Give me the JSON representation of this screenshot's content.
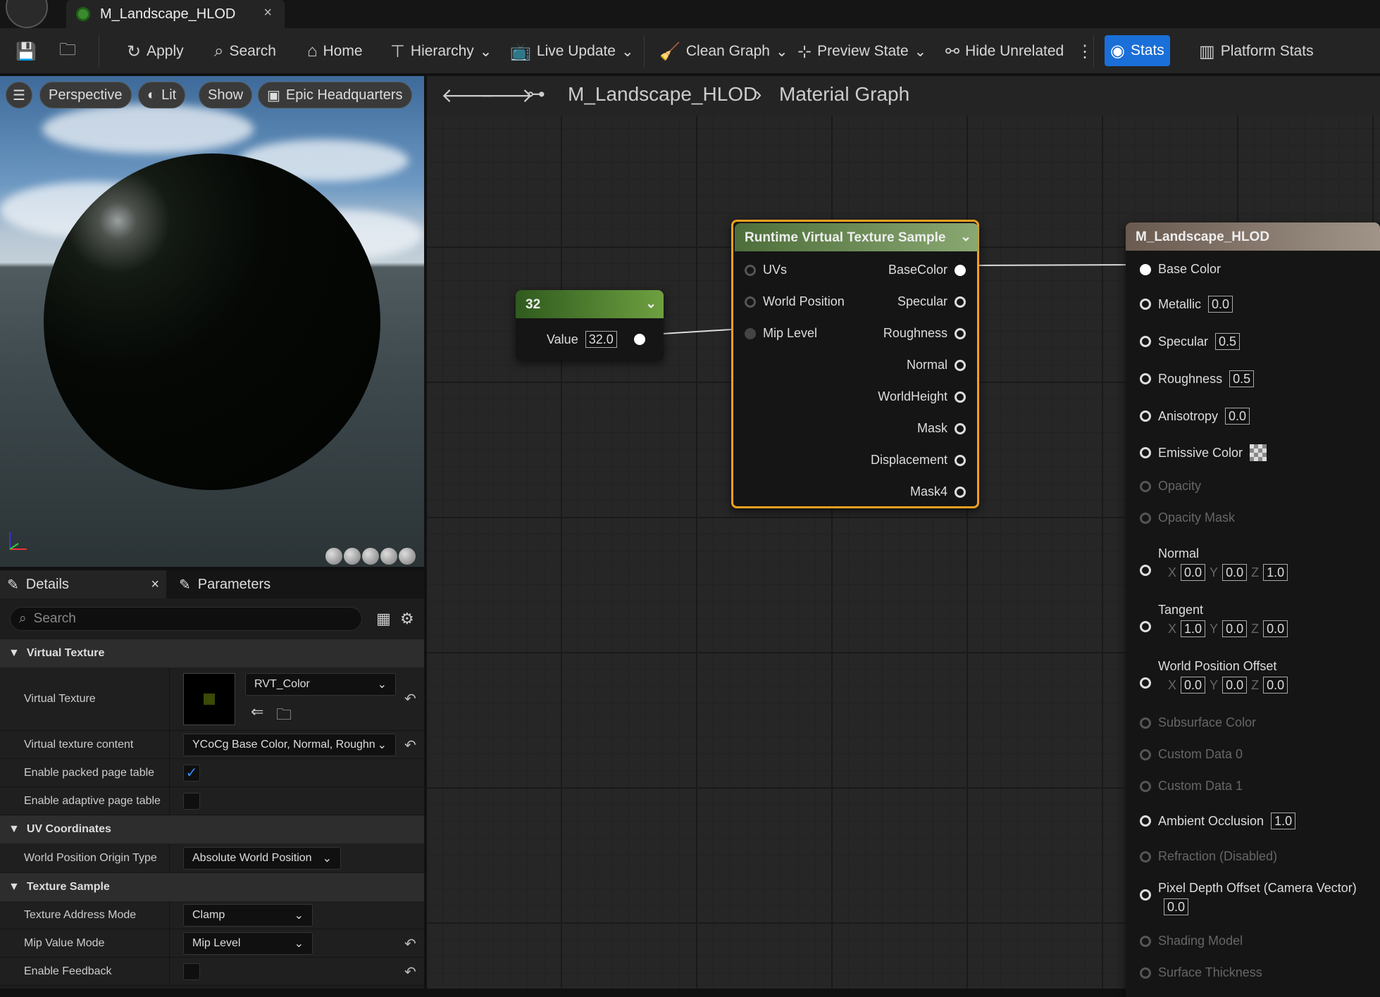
{
  "tab": {
    "title": "M_Landscape_HLOD",
    "close": "×"
  },
  "toolbar": {
    "apply": "Apply",
    "search": "Search",
    "home": "Home",
    "hierarchy": "Hierarchy",
    "live_update": "Live Update",
    "clean_graph": "Clean Graph",
    "preview_state": "Preview State",
    "hide_unrelated": "Hide Unrelated",
    "stats": "Stats",
    "platform_stats": "Platform Stats"
  },
  "viewport": {
    "perspective": "Perspective",
    "lit": "Lit",
    "show": "Show",
    "environment": "Epic Headquarters"
  },
  "details": {
    "tab_details": "Details",
    "tab_parameters": "Parameters",
    "search_placeholder": "Search",
    "cat_virtual_texture": "Virtual Texture",
    "virtual_texture_label": "Virtual Texture",
    "virtual_texture_value": "RVT_Color",
    "vt_content_label": "Virtual texture content",
    "vt_content_value": "YCoCg Base Color, Normal, Roughn",
    "packed_label": "Enable packed page table",
    "adaptive_label": "Enable adaptive page table",
    "cat_uv": "UV Coordinates",
    "origin_label": "World Position Origin Type",
    "origin_value": "Absolute World Position",
    "cat_texture_sample": "Texture Sample",
    "address_label": "Texture Address Mode",
    "address_value": "Clamp",
    "mip_label": "Mip Value Mode",
    "mip_value": "Mip Level",
    "feedback_label": "Enable Feedback"
  },
  "graph": {
    "crumb_material": "M_Landscape_HLOD",
    "crumb_graph": "Material Graph"
  },
  "const_node": {
    "title": "32",
    "label": "Value",
    "value": "32.0"
  },
  "rvt_node": {
    "title": "Runtime Virtual Texture Sample",
    "inputs": [
      "UVs",
      "World Position",
      "Mip Level"
    ],
    "outputs": [
      "BaseColor",
      "Specular",
      "Roughness",
      "Normal",
      "WorldHeight",
      "Mask",
      "Displacement",
      "Mask4"
    ]
  },
  "result_node": {
    "title": "M_Landscape_HLOD",
    "base_color": "Base Color",
    "metallic": "Metallic",
    "metallic_v": "0.0",
    "specular": "Specular",
    "specular_v": "0.5",
    "roughness": "Roughness",
    "roughness_v": "0.5",
    "anisotropy": "Anisotropy",
    "anisotropy_v": "0.0",
    "emissive": "Emissive Color",
    "opacity": "Opacity",
    "opacity_mask": "Opacity Mask",
    "normal": "Normal",
    "normal_x": "0.0",
    "normal_y": "0.0",
    "normal_z": "1.0",
    "tangent": "Tangent",
    "tangent_x": "1.0",
    "tangent_y": "0.0",
    "tangent_z": "0.0",
    "wpo": "World Position Offset",
    "wpo_x": "0.0",
    "wpo_y": "0.0",
    "wpo_z": "0.0",
    "subsurface": "Subsurface Color",
    "custom0": "Custom Data 0",
    "custom1": "Custom Data 1",
    "ao": "Ambient Occlusion",
    "ao_v": "1.0",
    "refraction": "Refraction (Disabled)",
    "pdo": "Pixel Depth Offset (Camera Vector)",
    "pdo_v": "0.0",
    "shading_model": "Shading Model",
    "surface_thickness": "Surface Thickness",
    "x": "X",
    "y": "Y",
    "z": "Z"
  }
}
